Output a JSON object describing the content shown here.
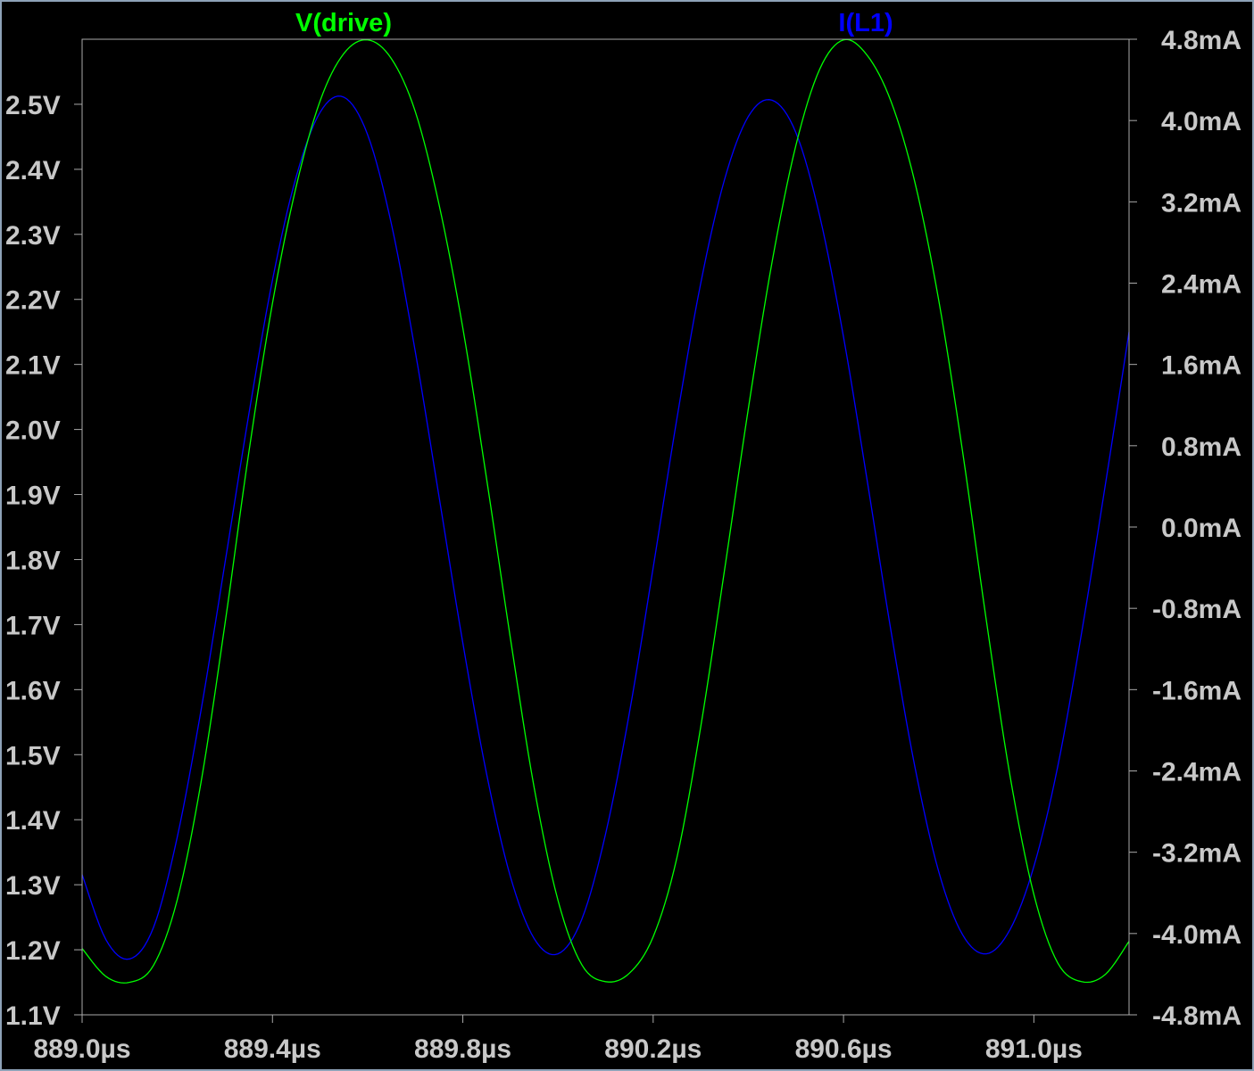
{
  "window": {
    "background": "#000000",
    "frame_color": "#8EA2B8",
    "axis_color": "#AAAAAA",
    "label_color": "#C8C8C8"
  },
  "chart_data": {
    "type": "line",
    "title": "",
    "xlabel": "",
    "ylabel": "",
    "x_ticks": [
      "889.0µs",
      "889.4µs",
      "889.8µs",
      "890.2µs",
      "890.6µs",
      "891.0µs"
    ],
    "x_tick_values": [
      889.0,
      889.4,
      889.8,
      890.2,
      890.6,
      891.0
    ],
    "xlim": [
      889.0,
      891.2
    ],
    "x_unit": "µs",
    "y_left_ticks": [
      "1.1V",
      "1.2V",
      "1.3V",
      "1.4V",
      "1.5V",
      "1.6V",
      "1.7V",
      "1.8V",
      "1.9V",
      "2.0V",
      "2.1V",
      "2.2V",
      "2.3V",
      "2.4V",
      "2.5V"
    ],
    "y_left_tick_values": [
      1.1,
      1.2,
      1.3,
      1.4,
      1.5,
      1.6,
      1.7,
      1.8,
      1.9,
      2.0,
      2.1,
      2.2,
      2.3,
      2.4,
      2.5
    ],
    "ylim_left": [
      1.1,
      2.6
    ],
    "y_left_unit": "V",
    "y_right_ticks": [
      "-4.8mA",
      "-4.0mA",
      "-3.2mA",
      "-2.4mA",
      "-1.6mA",
      "-0.8mA",
      "0.0mA",
      "0.8mA",
      "1.6mA",
      "2.4mA",
      "3.2mA",
      "4.0mA",
      "4.8mA"
    ],
    "y_right_tick_values": [
      -4.8,
      -4.0,
      -3.2,
      -2.4,
      -1.6,
      -0.8,
      0.0,
      0.8,
      1.6,
      2.4,
      3.2,
      4.0,
      4.8
    ],
    "ylim_right": [
      -4.8,
      4.8
    ],
    "y_right_unit": "mA",
    "grid": false,
    "legend": "top (trace names above plot)",
    "series": [
      {
        "name": "V(drive)",
        "axis": "left",
        "color": "#00FF00",
        "x": [
          889.0,
          889.05,
          889.1,
          889.15,
          889.2,
          889.25,
          889.3,
          889.35,
          889.4,
          889.45,
          889.5,
          889.55,
          889.6,
          889.65,
          889.7,
          889.75,
          889.8,
          889.85,
          889.9,
          889.95,
          890.0,
          890.05,
          890.1,
          890.15,
          890.2,
          890.25,
          890.3,
          890.35,
          890.4,
          890.45,
          890.5,
          890.55,
          890.6,
          890.65,
          890.7,
          890.75,
          890.8,
          890.85,
          890.9,
          890.95,
          891.0,
          891.05,
          891.1,
          891.15,
          891.2
        ],
        "y": [
          1.202,
          1.159,
          1.15,
          1.176,
          1.277,
          1.458,
          1.7,
          1.963,
          2.194,
          2.374,
          2.505,
          2.578,
          2.599,
          2.57,
          2.489,
          2.346,
          2.156,
          1.924,
          1.679,
          1.449,
          1.276,
          1.177,
          1.151,
          1.164,
          1.22,
          1.342,
          1.543,
          1.784,
          2.032,
          2.258,
          2.437,
          2.554,
          2.599,
          2.575,
          2.504,
          2.38,
          2.199,
          1.967,
          1.707,
          1.467,
          1.285,
          1.18,
          1.151,
          1.162,
          1.213
        ]
      },
      {
        "name": "I(L1)",
        "axis": "right",
        "color": "#0000FF",
        "x": [
          889.0,
          889.05,
          889.1,
          889.15,
          889.2,
          889.25,
          889.3,
          889.35,
          889.4,
          889.45,
          889.5,
          889.55,
          889.6,
          889.65,
          889.7,
          889.75,
          889.8,
          889.85,
          889.9,
          889.95,
          890.0,
          890.05,
          890.1,
          890.15,
          890.2,
          890.25,
          890.3,
          890.35,
          890.4,
          890.45,
          890.5,
          890.55,
          890.6,
          890.65,
          890.7,
          890.75,
          890.8,
          890.85,
          890.9,
          890.95,
          891.0,
          891.05,
          891.1,
          891.15,
          891.2
        ],
        "y": [
          -3.42,
          -4.06,
          -4.25,
          -3.94,
          -3.05,
          -1.8,
          -0.36,
          1.1,
          2.43,
          3.45,
          4.08,
          4.23,
          3.86,
          2.98,
          1.73,
          0.3,
          -1.14,
          -2.43,
          -3.44,
          -4.05,
          -4.2,
          -3.86,
          -3.02,
          -1.83,
          -0.4,
          1.07,
          2.4,
          3.42,
          4.04,
          4.2,
          3.88,
          3.06,
          1.87,
          0.45,
          -1.03,
          -2.36,
          -3.39,
          -4.01,
          -4.2,
          -3.96,
          -3.34,
          -2.36,
          -1.05,
          0.41,
          1.92
        ]
      }
    ]
  }
}
